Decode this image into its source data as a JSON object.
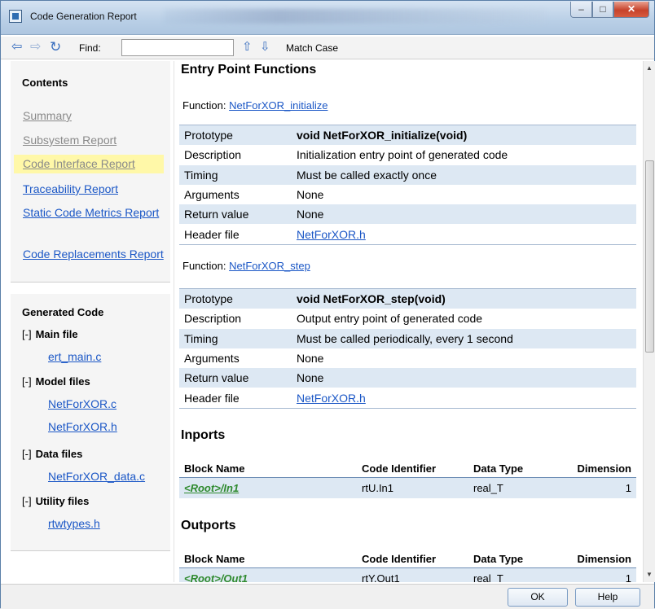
{
  "window": {
    "title": "Code Generation Report",
    "icon": "app-window-icon"
  },
  "toolbar": {
    "find_label": "Find:",
    "find_value": "",
    "match_case_label": "Match Case",
    "icons": [
      "back-arrow-icon",
      "forward-arrow-icon",
      "refresh-icon",
      "find-up-icon",
      "find-down-icon"
    ]
  },
  "sidebar": {
    "contents_heading": "Contents",
    "links": [
      {
        "label": "Summary",
        "state": "visited"
      },
      {
        "label": "Subsystem Report",
        "state": "visited"
      },
      {
        "label": "Code Interface Report",
        "state": "active"
      },
      {
        "label": "Traceability Report",
        "state": "normal"
      },
      {
        "label": "Static Code Metrics Report",
        "state": "normal"
      },
      {
        "label": "Code Replacements Report",
        "state": "normal"
      }
    ],
    "generated_heading": "Generated Code",
    "groups": [
      {
        "toggle": "[-]",
        "title": "Main file",
        "files": [
          "ert_main.c"
        ]
      },
      {
        "toggle": "[-]",
        "title": "Model files",
        "files": [
          "NetForXOR.c",
          "NetForXOR.h"
        ]
      },
      {
        "toggle": "[-]",
        "title": "Data files",
        "files": [
          "NetForXOR_data.c"
        ]
      },
      {
        "toggle": "[-]",
        "title": "Utility files",
        "files": [
          "rtwtypes.h"
        ]
      }
    ]
  },
  "content": {
    "entry_title": "Entry Point Functions",
    "function_prefix": "Function: ",
    "functions": [
      {
        "name": "NetForXOR_initialize",
        "rows": [
          {
            "key": "Prototype",
            "value": "void NetForXOR_initialize(void)"
          },
          {
            "key": "Description",
            "value": "Initialization entry point of generated code"
          },
          {
            "key": "Timing",
            "value": "Must be called exactly once"
          },
          {
            "key": "Arguments",
            "value": "None"
          },
          {
            "key": "Return value",
            "value": "None"
          },
          {
            "key": "Header file",
            "value": "NetForXOR.h"
          }
        ]
      },
      {
        "name": "NetForXOR_step",
        "rows": [
          {
            "key": "Prototype",
            "value": "void NetForXOR_step(void)"
          },
          {
            "key": "Description",
            "value": "Output entry point of generated code"
          },
          {
            "key": "Timing",
            "value": "Must be called periodically, every 1 second"
          },
          {
            "key": "Arguments",
            "value": "None"
          },
          {
            "key": "Return value",
            "value": "None"
          },
          {
            "key": "Header file",
            "value": "NetForXOR.h"
          }
        ]
      }
    ],
    "inports_title": "Inports",
    "outports_title": "Outports",
    "port_headers": [
      "Block Name",
      "Code Identifier",
      "Data Type",
      "Dimension"
    ],
    "inports": [
      {
        "block": "<Root>/In1",
        "identifier": "rtU.In1",
        "type": "real_T",
        "dimension": "1"
      }
    ],
    "outports": [
      {
        "block": "<Root>/Out1",
        "identifier": "rtY.Out1",
        "type": "real_T",
        "dimension": "1"
      }
    ]
  },
  "buttons": {
    "ok": "OK",
    "help": "Help"
  }
}
